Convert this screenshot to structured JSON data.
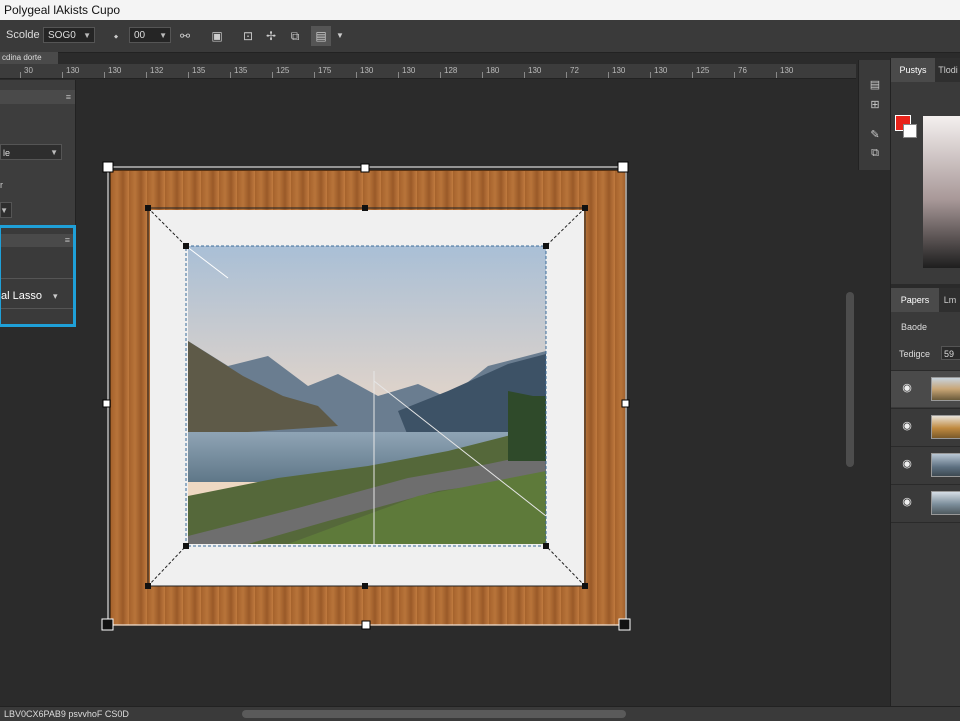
{
  "window": {
    "title": "Polygeal lAkists Cupo"
  },
  "options_bar": {
    "label": "Scolde",
    "field1": "SOG0",
    "field2": "00"
  },
  "document_tab": "cdina dorte",
  "ruler": {
    "ticks": [
      "30",
      "130",
      "130",
      "132",
      "135",
      "135",
      "125",
      "175",
      "130",
      "130",
      "128",
      "180",
      "130",
      "72",
      "130",
      "130",
      "125",
      "76",
      "130"
    ]
  },
  "tool_panel": {
    "select1": "le",
    "select2": ""
  },
  "lasso_panel": {
    "tool_label": "al Lasso"
  },
  "right_panel": {
    "tabs": [
      "Pustys",
      "Tlodi"
    ],
    "colors": {
      "foreground": "#e8231a",
      "background": "#ffffff"
    },
    "layers_tabs": [
      "Papers",
      "Lm"
    ],
    "blend_label": "Baode",
    "opacity_label": "Tedigce",
    "opacity_value": "59"
  },
  "status_bar": {
    "text": "LBV0CX6PAB9 psvvhoF CS0D"
  }
}
